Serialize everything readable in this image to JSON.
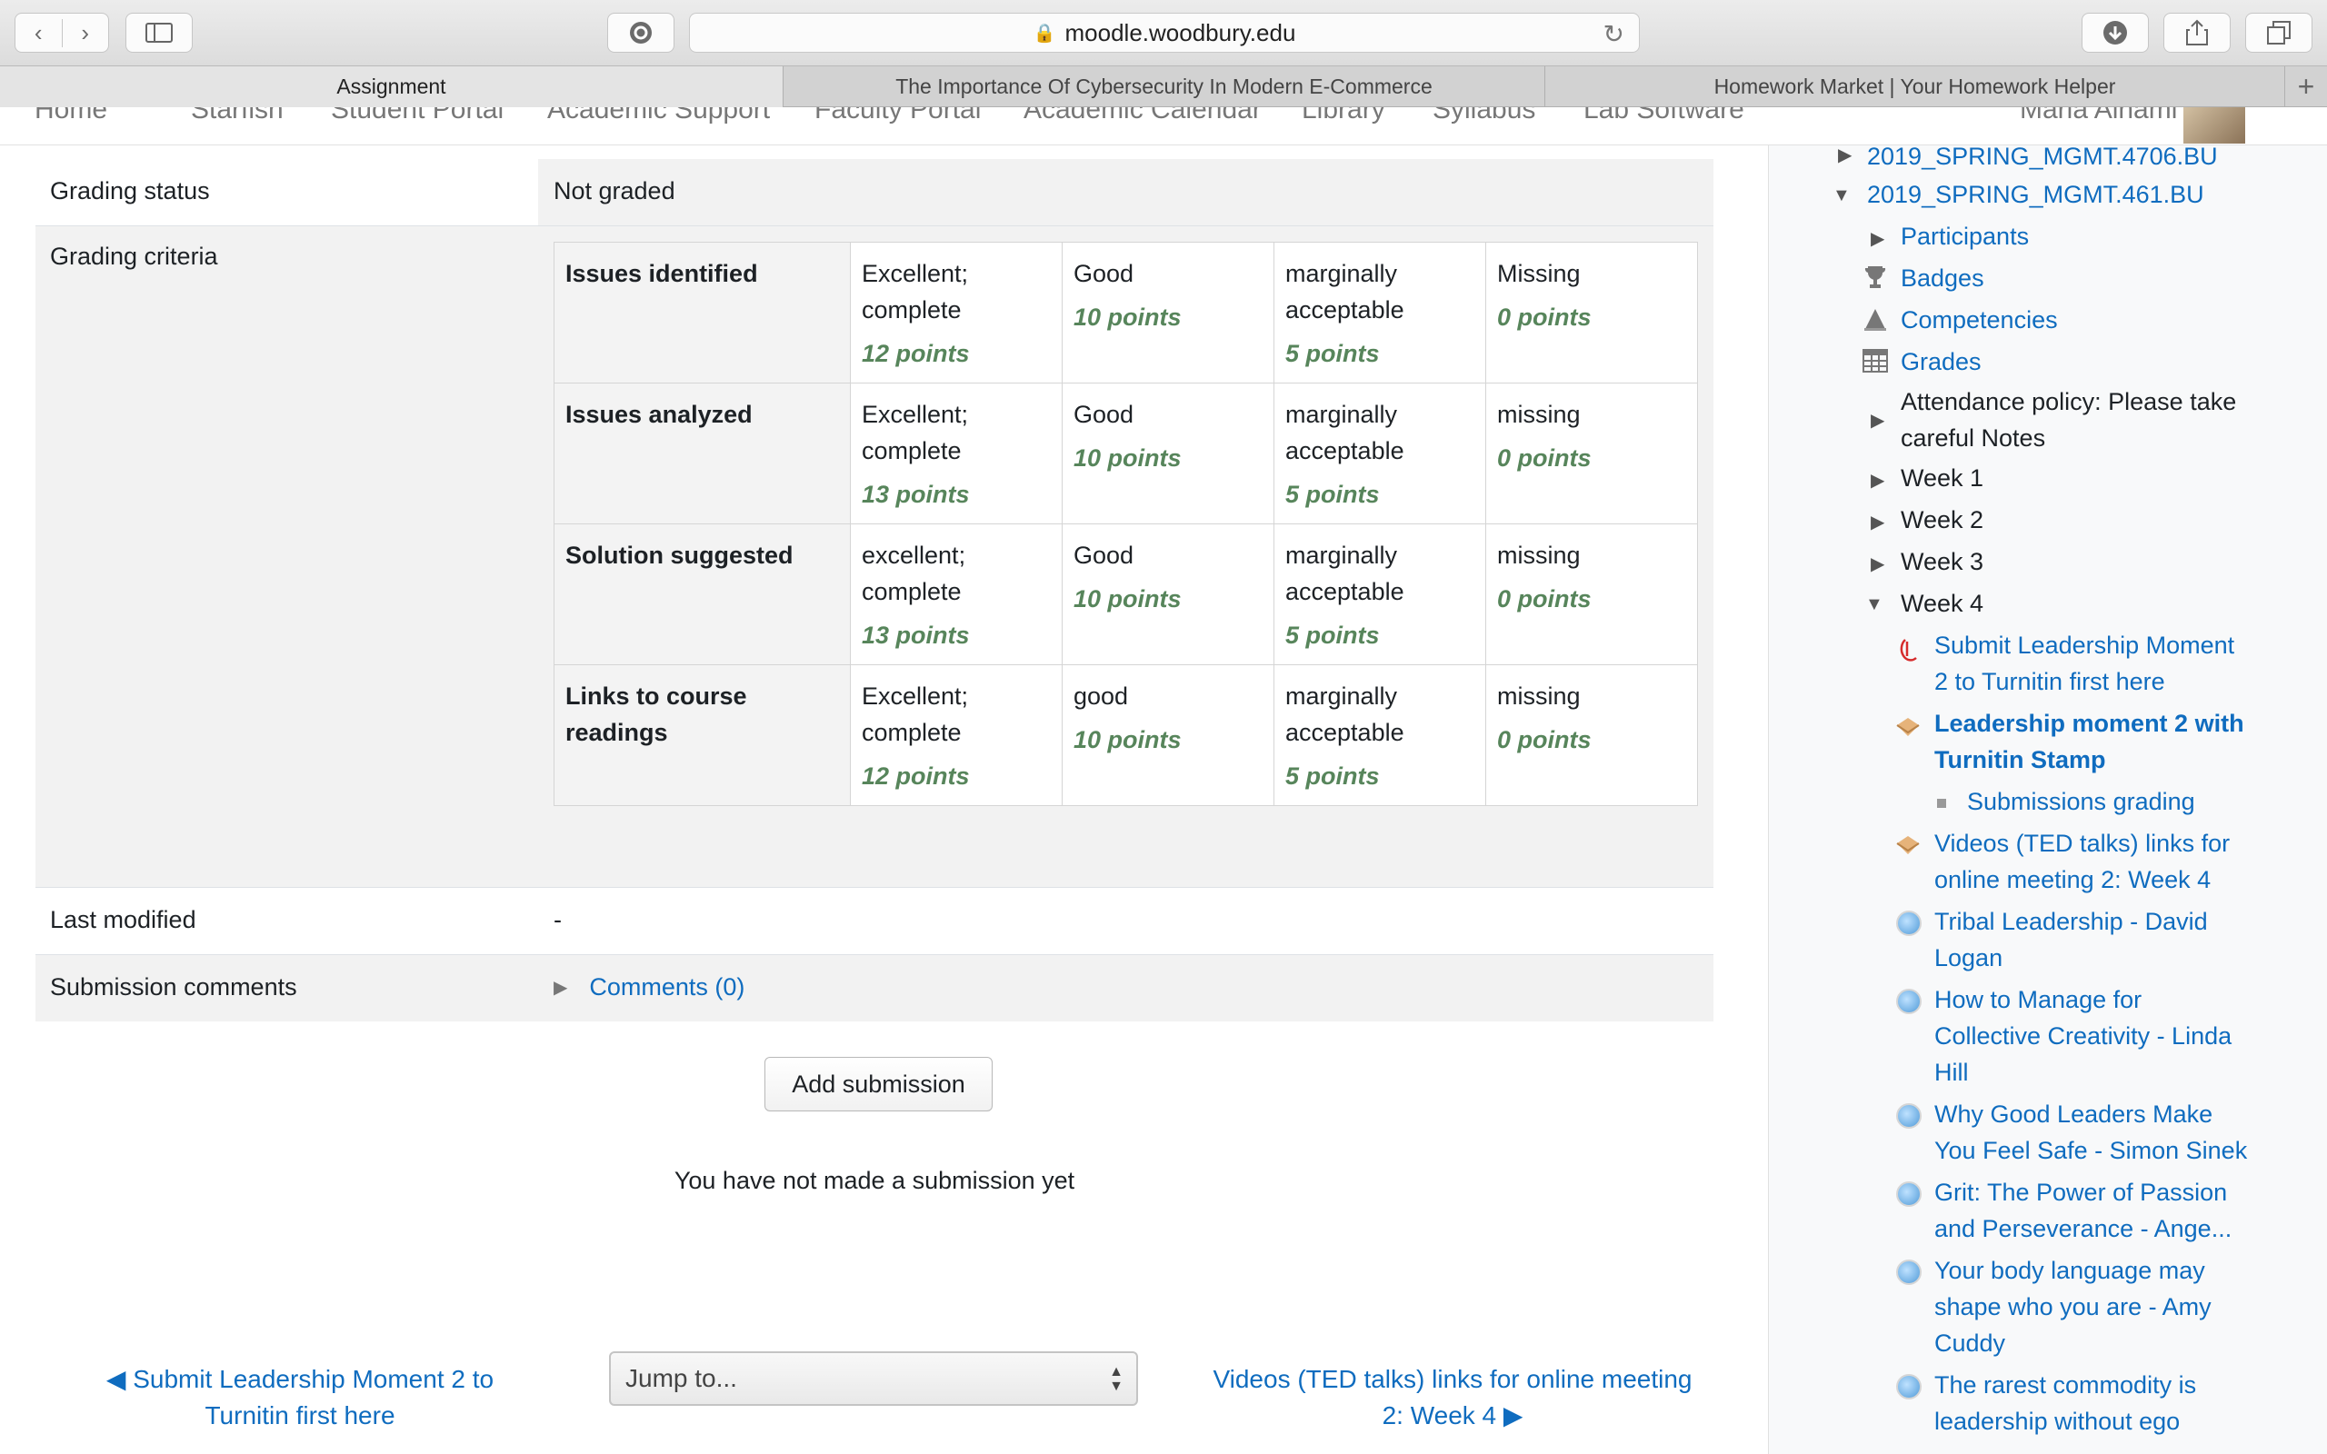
{
  "browser": {
    "url": "moodle.woodbury.edu",
    "tabs": [
      {
        "label": "Assignment",
        "active": true
      },
      {
        "label": "The Importance Of Cybersecurity In Modern E-Commerce",
        "active": false
      },
      {
        "label": "Homework Market | Your Homework Helper",
        "active": false
      }
    ]
  },
  "sitenav": {
    "items": [
      "Home",
      "Starfish",
      "Student Portal",
      "Academic Support",
      "Faculty Portal",
      "Academic Calendar",
      "Library",
      "Syllabus",
      "Lab Software"
    ],
    "user": "Maria Alhami"
  },
  "submission": {
    "grading_status_label": "Grading status",
    "grading_status_value": "Not graded",
    "grading_criteria_label": "Grading criteria",
    "last_modified_label": "Last modified",
    "last_modified_value": "-",
    "comments_label": "Submission comments",
    "comments_link": "Comments (0)",
    "add_submission_button": "Add submission",
    "status_message": "You have not made a submission yet"
  },
  "rubric": [
    {
      "criterion": "Issues identified",
      "levels": [
        {
          "line1": "Excellent;",
          "line2": "complete",
          "points": "12 points"
        },
        {
          "line1": "Good",
          "line2": "",
          "points": "10 points"
        },
        {
          "line1": "marginally",
          "line2": "acceptable",
          "points": "5 points"
        },
        {
          "line1": "Missing",
          "line2": "",
          "points": "0 points"
        }
      ]
    },
    {
      "criterion": "Issues analyzed",
      "levels": [
        {
          "line1": "Excellent;",
          "line2": "complete",
          "points": "13 points"
        },
        {
          "line1": "Good",
          "line2": "",
          "points": "10 points"
        },
        {
          "line1": "marginally",
          "line2": "acceptable",
          "points": "5 points"
        },
        {
          "line1": "missing",
          "line2": "",
          "points": "0 points"
        }
      ]
    },
    {
      "criterion": "Solution suggested",
      "levels": [
        {
          "line1": "excellent;",
          "line2": "complete",
          "points": "13 points"
        },
        {
          "line1": "Good",
          "line2": "",
          "points": "10 points"
        },
        {
          "line1": "marginally",
          "line2": "acceptable",
          "points": "5 points"
        },
        {
          "line1": "missing",
          "line2": "",
          "points": "0 points"
        }
      ]
    },
    {
      "criterion": "Links to course readings",
      "levels": [
        {
          "line1": "Excellent;",
          "line2": "complete",
          "points": "12 points"
        },
        {
          "line1": "good",
          "line2": "",
          "points": "10 points"
        },
        {
          "line1": "marginally",
          "line2": "acceptable",
          "points": "5 points"
        },
        {
          "line1": "missing",
          "line2": "",
          "points": "0 points"
        }
      ]
    }
  ],
  "footer_nav": {
    "prev_line1": "◀ Submit Leadership Moment 2 to",
    "prev_line2": "Turnitin first here",
    "jump_placeholder": "Jump to...",
    "next_line1": "Videos (TED talks) links for online meeting",
    "next_line2": "2: Week 4 ▶"
  },
  "sidebar": {
    "course1": "2019_SPRING_MGMT.4706.BU",
    "course2": "2019_SPRING_MGMT.461.BU",
    "participants": "Participants",
    "badges": "Badges",
    "competencies": "Competencies",
    "grades": "Grades",
    "attendance_line1": "Attendance policy: Please take",
    "attendance_line2": "careful Notes",
    "week1": "Week 1",
    "week2": "Week 2",
    "week3": "Week 3",
    "week4": "Week 4",
    "a1_l1": "Submit Leadership Moment",
    "a1_l2": "2 to Turnitin first here",
    "a2_l1": "Leadership moment 2 with",
    "a2_l2": "Turnitin Stamp",
    "a3": "Submissions grading",
    "a4_l1": "Videos (TED talks) links for",
    "a4_l2": "online meeting 2: Week 4",
    "a5_l1": "Tribal Leadership - David",
    "a5_l2": "Logan",
    "a6_l1": "How to Manage for",
    "a6_l2": "Collective Creativity - Linda",
    "a6_l3": "Hill",
    "a7_l1": "Why Good Leaders Make",
    "a7_l2": "You Feel Safe - Simon Sinek",
    "a8_l1": "Grit: The Power of Passion",
    "a8_l2": "and Perseverance - Ange...",
    "a9_l1": "Your body language may",
    "a9_l2": "shape who you are - Amy",
    "a9_l3": "Cuddy",
    "a10_l1": "The rarest commodity is",
    "a10_l2": "leadership without ego"
  }
}
